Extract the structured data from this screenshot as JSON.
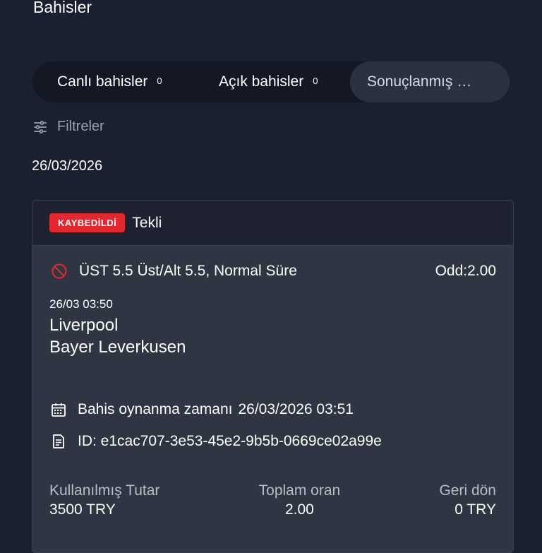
{
  "header": {
    "title": "Bahisler"
  },
  "tabs": [
    {
      "label": "Canlı bahisler",
      "count": "0"
    },
    {
      "label": "Açık bahisler",
      "count": "0"
    },
    {
      "label": "Sonuçlanmış …"
    }
  ],
  "filters": {
    "label": "Filtreler",
    "icon": "sliders-icon"
  },
  "date_group": "26/03/2026",
  "bet": {
    "status": "KAYBEDİLDİ",
    "type": "Tekli",
    "selection": "ÜST 5.5 Üst/Alt 5.5, Normal Süre",
    "odd": "Odd:2.00",
    "event_time": "26/03 03:50",
    "home_team": "Liverpool",
    "away_team": "Bayer Leverkusen",
    "placed_label": "Bahis oynanma zamanı",
    "placed_value": "26/03/2026 03:51",
    "id_text": "ID: e1cac707-3e53-45e2-9b5b-0669ce02a99e",
    "stake_label": "Kullanılmış Tutar",
    "stake_value": "3500 TRY",
    "total_odds_label": "Toplam oran",
    "total_odds_value": "2.00",
    "return_label": "Geri dön",
    "return_value": "0 TRY"
  },
  "colors": {
    "background": "#1b2030",
    "card": "#303544",
    "lost_badge": "#e6282e",
    "lost_icon": "#e6282e"
  }
}
